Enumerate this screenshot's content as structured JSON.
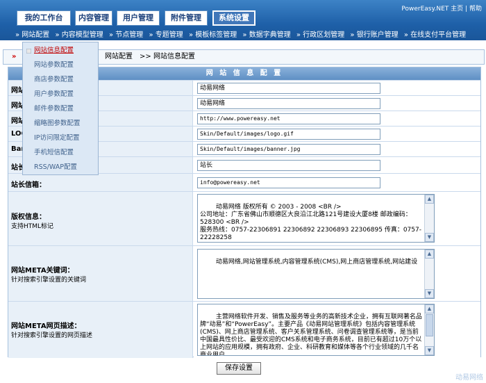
{
  "header": {
    "tabs": [
      {
        "label": "我的工作台"
      },
      {
        "label": "内容管理"
      },
      {
        "label": "用户管理"
      },
      {
        "label": "附件管理"
      },
      {
        "label": "系统设置"
      }
    ],
    "links": {
      "brand": "PowerEasy.NET",
      "home": "主页",
      "sep": "|",
      "help": "帮助"
    },
    "subnav": [
      "网站配置",
      "内容模型管理",
      "节点管理",
      "专题管理",
      "模板标签管理",
      "数据字典管理",
      "行政区划管理",
      "银行账户管理",
      "在线支付平台管理"
    ]
  },
  "dropdown": {
    "items": [
      "网站信息配置",
      "网站参数配置",
      "商店参数配置",
      "用户参数配置",
      "邮件参数配置",
      "缩略图参数配置",
      "IP访问限定配置",
      "手机短信配置",
      "RSS/WAP配置"
    ]
  },
  "breadcrumb": {
    "part1": "网站配置",
    "part2": "网站信息配置",
    "separator": ">>"
  },
  "form": {
    "title": "网 站 信 息 配 置",
    "rows": [
      {
        "label": "网站",
        "value": "动易网络"
      },
      {
        "label": "网站",
        "value": "动易网络"
      },
      {
        "label": "网站",
        "value": "http://www.powereasy.net"
      },
      {
        "label": "LOG",
        "value": "Skin/Default/images/logo.gif"
      },
      {
        "label": "Ban",
        "value": "Skin/Default/images/banner.jpg"
      },
      {
        "label": "站长",
        "value": "站长"
      },
      {
        "label": "站长信箱：",
        "value": "info@powereasy.net"
      }
    ],
    "copyright": {
      "label": "版权信息：",
      "desc": "支持HTML标记",
      "value": "动易网络 版权所有 © 2003 - 2008 <BR />\n公司地址：广东省佛山市顺德区大良沿江北路121号建设大厦8楼 邮政编码：528300 <BR />\n服务热线：0757-22306891 22306892 22306893 22306895 传真：0757-22228258"
    },
    "keywords": {
      "label": "网站META关键词：",
      "desc": "针对搜索引擎设置的关键词",
      "value": "动易网络,网站管理系统,内容管理系统(CMS),网上商店管理系统,网站建设"
    },
    "description": {
      "label": "网站META网页描述：",
      "desc": "针对搜索引擎设置的网页描述",
      "value": "主营网络软件开发、销售及服务等业务的高新技术企业，拥有互联网著名品牌“动易”和“PowerEasy”。主要产品《动易网站管理系统》包括内容管理系统(CMS)、网上商店管理系统、客户关系管理系统、问卷调查管理系统等，是当前中国最具性价比、最受欢迎的CMS系统和电子商务系统，目前已有超过10万个以上网站的应用规模，拥有政府、企业、科研教育和媒体等各个行业领域的几千名商业用户。"
    },
    "save_label": "保存设置"
  },
  "footer": {
    "watermark": "动易网络"
  },
  "colors": {
    "header_blue": "#1e60a8",
    "label_bg": "#e8f0f8",
    "active_red": "#c00000"
  }
}
